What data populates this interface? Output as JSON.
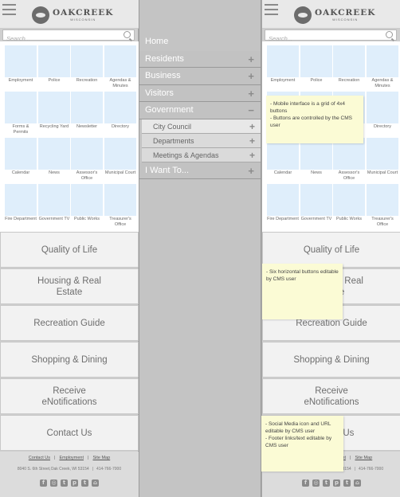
{
  "header": {
    "logo_name": "OAKCREEK",
    "logo_sub": "WISCONSIN"
  },
  "search": {
    "placeholder": "Search..."
  },
  "grid": [
    "Employment",
    "Police",
    "Recreation",
    "Agendas & Minutes",
    "Forms & Permits",
    "Recycling Yard",
    "Newsletter",
    "Directory",
    "Calendar",
    "News",
    "Assessor's Office",
    "Municipal Court",
    "Fire Department",
    "Government TV",
    "Public Works",
    "Treasurer's Office"
  ],
  "buttons": [
    "Quality of Life",
    "Housing & Real Estate",
    "Recreation Guide",
    "Shopping & Dining",
    "Receive eNotifications",
    "Contact Us"
  ],
  "footer": {
    "links": [
      "Contact Us",
      "Employment",
      "Site Map"
    ],
    "address": "8040 S. 6th Street,Oak Creek, WI 53154",
    "phone": "414-766-7000",
    "social_icons": [
      "facebook-icon",
      "instagram-icon",
      "twitter-icon",
      "pinterest-icon",
      "tumblr-icon",
      "home-icon"
    ]
  },
  "menu": {
    "home": "Home",
    "items": [
      {
        "label": "Residents",
        "sign": "+"
      },
      {
        "label": "Business",
        "sign": "+"
      },
      {
        "label": "Visitors",
        "sign": "+"
      },
      {
        "label": "Government",
        "sign": "−"
      }
    ],
    "subitems": [
      {
        "label": "City Council",
        "sign": "+"
      },
      {
        "label": "Departments",
        "sign": "+"
      },
      {
        "label": "Meetings & Agendas",
        "sign": "+"
      }
    ],
    "last": {
      "label": "I Want To...",
      "sign": "+"
    }
  },
  "notes": {
    "grid_note_1": "- Mobile interface is a grid of 4x4 buttons",
    "grid_note_2": "- Buttons are controlled by the CMS user",
    "buttons_note": "- Six horizontal buttons editable by CMS user",
    "footer_note_1": "- Social Media icon and URL editable by CMS user",
    "footer_note_2": "- Footer links/text editable by CMS user"
  },
  "colors": {
    "tile": "#dfeefb",
    "note": "#fbfbd5"
  }
}
